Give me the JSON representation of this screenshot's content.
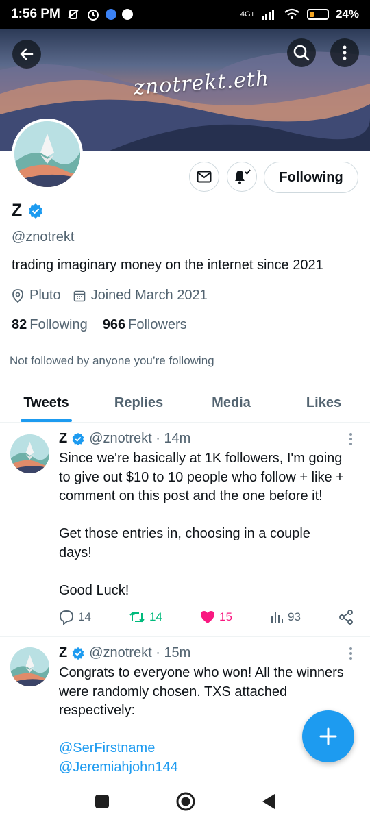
{
  "status_bar": {
    "time": "1:56 PM",
    "network": "4G+",
    "battery_pct": "24%",
    "battery_level": 0.24
  },
  "banner": {
    "handle_text": "znotrekt.eth"
  },
  "profile": {
    "display_name": "Z",
    "handle": "@znotrekt",
    "bio": "trading imaginary money on the internet since 2021",
    "location": "Pluto",
    "joined": "Joined March 2021",
    "following_count": "82",
    "following_label": "Following",
    "followers_count": "966",
    "followers_label": "Followers",
    "not_followed_note": "Not followed by anyone you’re following",
    "follow_button_label": "Following"
  },
  "tabs": [
    {
      "label": "Tweets",
      "active": true
    },
    {
      "label": "Replies",
      "active": false
    },
    {
      "label": "Media",
      "active": false
    },
    {
      "label": "Likes",
      "active": false
    }
  ],
  "tweets": [
    {
      "name": "Z",
      "handle_time": "@znotrekt · 14m",
      "lines": [
        "Since we're basically at 1K followers, I'm going",
        "to give out $10 to 10 people who follow + like +",
        "comment on this post and the one before it!",
        "",
        "Get those entries in, choosing in a couple",
        "days!",
        "",
        "Good Luck!"
      ],
      "replies": "14",
      "retweets": "14",
      "likes": "15",
      "views": "93"
    },
    {
      "name": "Z",
      "handle_time": "@znotrekt · 15m",
      "lines": [
        "Congrats to everyone who won! All the winners",
        "were randomly chosen. TXS attached",
        "respectively:"
      ],
      "mentions": [
        "@SerFirstname",
        "@Jeremiahjohn144"
      ]
    }
  ],
  "colors": {
    "accent": "#1d9bf0",
    "retweet": "#00ba7c",
    "like": "#f91880",
    "secondary_text": "#536471"
  },
  "icons": [
    "back-arrow-icon",
    "search-icon",
    "more-vertical-icon",
    "mail-icon",
    "bell-check-icon",
    "verified-badge-icon",
    "location-pin-icon",
    "calendar-icon",
    "reply-icon",
    "retweet-icon",
    "heart-icon",
    "views-icon",
    "share-icon",
    "compose-plus-icon"
  ]
}
